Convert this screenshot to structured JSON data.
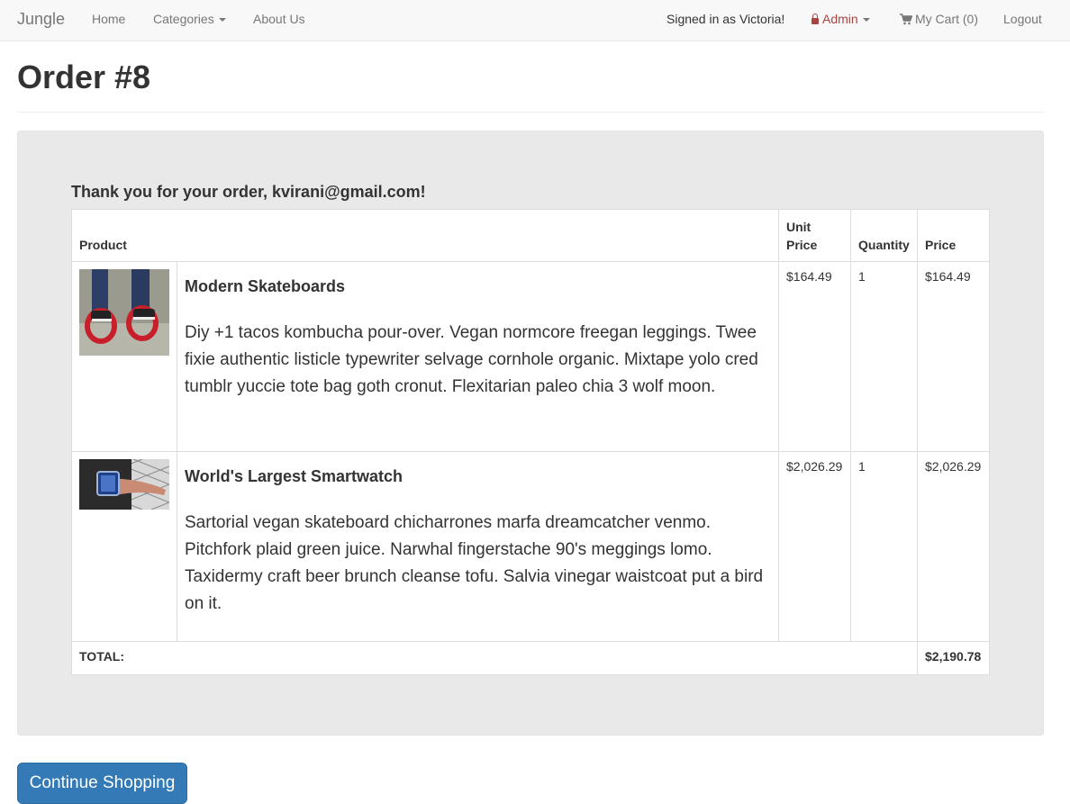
{
  "nav": {
    "brand": "Jungle",
    "home": "Home",
    "categories": "Categories",
    "about": "About Us",
    "signed_in": "Signed in as Victoria!",
    "admin": "Admin",
    "cart": "My Cart (0)",
    "logout": "Logout"
  },
  "page": {
    "title": "Order #8",
    "thanks": "Thank you for your order, kvirani@gmail.com!"
  },
  "table": {
    "headers": {
      "product": "Product",
      "unit_price": "Unit Price",
      "quantity": "Quantity",
      "price": "Price"
    },
    "rows": [
      {
        "name": "Modern Skateboards",
        "description": "Diy +1 tacos kombucha pour-over. Vegan normcore freegan leggings. Twee fixie authentic listicle typewriter selvage cornhole organic. Mixtape yolo cred tumblr yuccie tote bag goth cronut. Flexitarian paleo chia 3 wolf moon.",
        "unit_price": "$164.49",
        "quantity": "1",
        "price": "$164.49"
      },
      {
        "name": "World's Largest Smartwatch",
        "description": "Sartorial vegan skateboard chicharrones marfa dreamcatcher venmo. Pitchfork plaid green juice. Narwhal fingerstache 90's meggings lomo. Taxidermy craft beer brunch cleanse tofu. Salvia vinegar waistcoat put a bird on it.",
        "unit_price": "$2,026.29",
        "quantity": "1",
        "price": "$2,026.29"
      }
    ],
    "total_label": "TOTAL:",
    "total_value": "$2,190.78"
  },
  "actions": {
    "continue": "Continue Shopping"
  },
  "colors": {
    "primary": "#337ab7",
    "admin": "#a94442",
    "well": "#e9e9e9"
  },
  "icons": {
    "admin": "lock-icon",
    "cart": "shopping-cart-icon"
  }
}
